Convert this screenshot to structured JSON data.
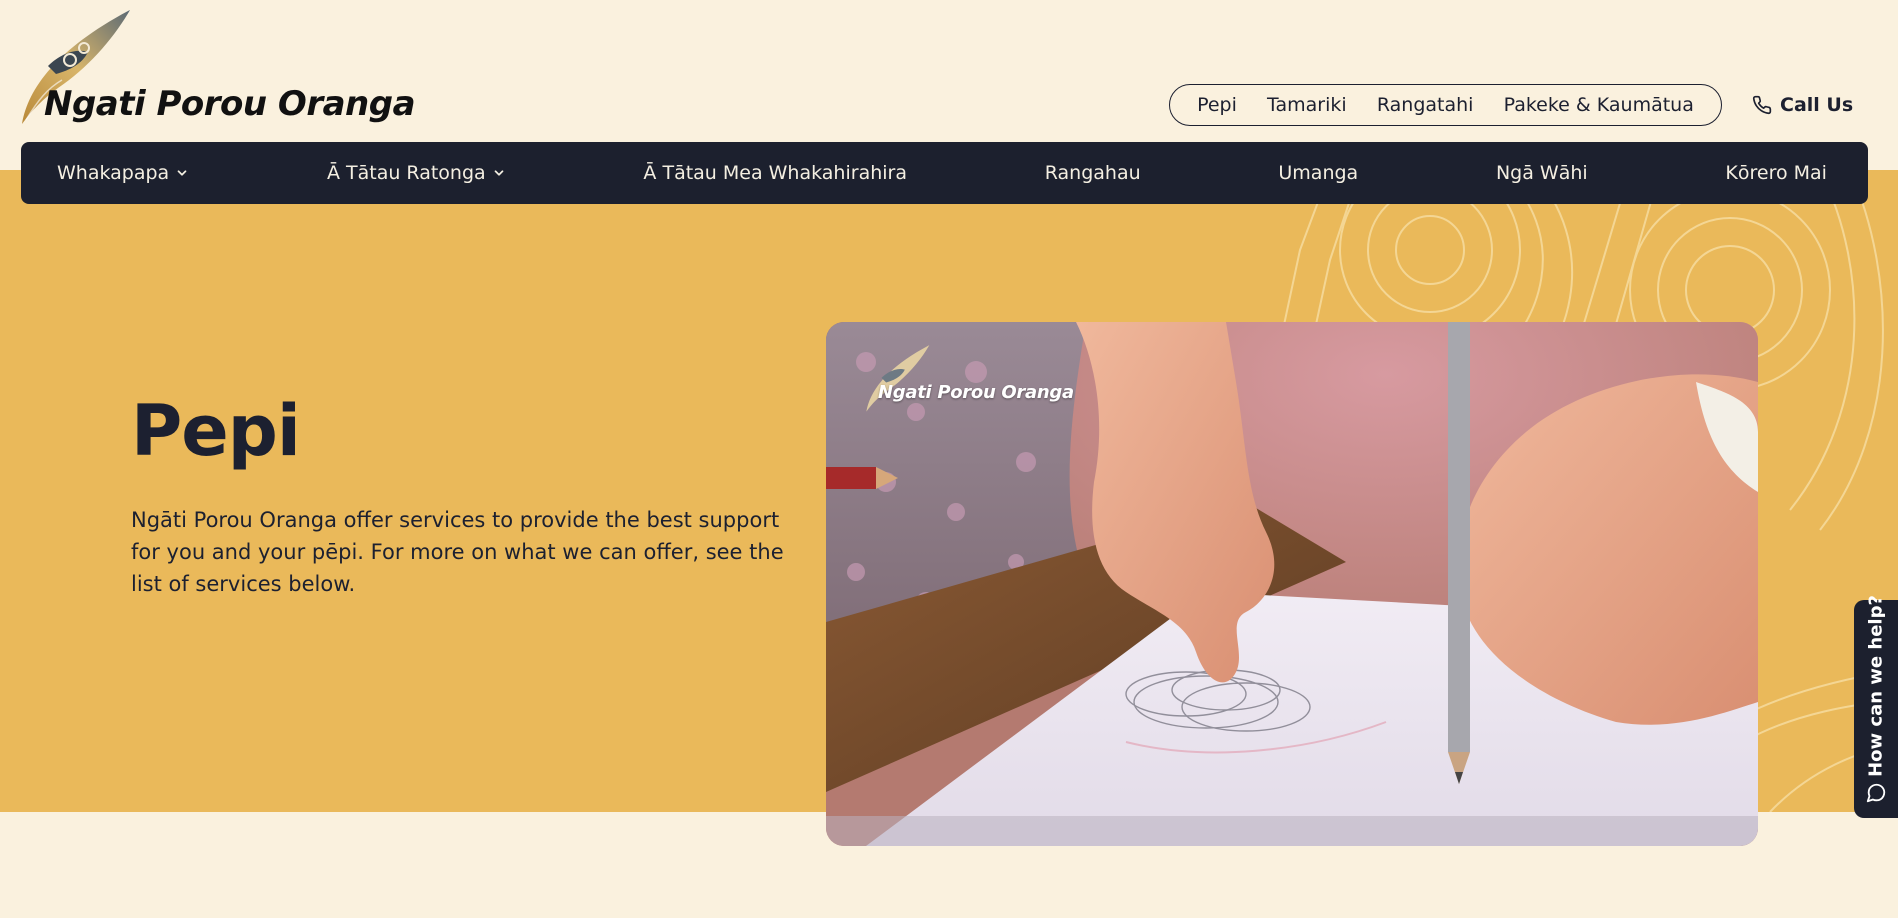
{
  "brand": {
    "name": "Ngati Porou Oranga"
  },
  "audience_nav": {
    "items": [
      "Pepi",
      "Tamariki",
      "Rangatahi",
      "Pakeke & Kaumātua"
    ]
  },
  "call_us": {
    "label": "Call Us",
    "icon": "phone-icon"
  },
  "main_nav": {
    "items": [
      {
        "label": "Whakapapa",
        "has_dropdown": true
      },
      {
        "label": "Ā Tātau Ratonga",
        "has_dropdown": true
      },
      {
        "label": "Ā Tātau Mea Whakahirahira",
        "has_dropdown": false
      },
      {
        "label": "Rangahau",
        "has_dropdown": false
      },
      {
        "label": "Umanga",
        "has_dropdown": false
      },
      {
        "label": "Ngā Wāhi",
        "has_dropdown": false
      },
      {
        "label": "Kōrero Mai",
        "has_dropdown": false
      }
    ]
  },
  "hero": {
    "title": "Pepi",
    "body": "Ngāti Porou Oranga offer services to provide the best support for you and your pēpi. For more on what we can offer, see the list of services below.",
    "image_watermark": "Ngati Porou Oranga"
  },
  "help_widget": {
    "label": "How can we help?",
    "icon": "chat-bubble-icon"
  },
  "colors": {
    "page_bg": "#faf1de",
    "hero_bg": "#eab95a",
    "nav_bg": "#1c202e",
    "text_dark": "#1c2030"
  }
}
